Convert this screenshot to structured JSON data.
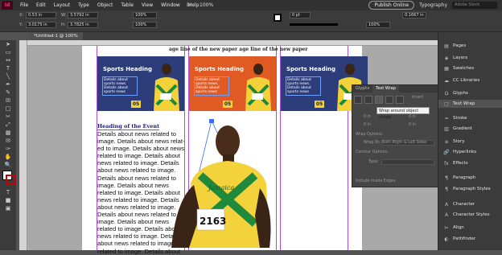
{
  "app": {
    "logo": "Id",
    "menus": [
      "File",
      "Edit",
      "Layout",
      "Type",
      "Object",
      "Table",
      "View",
      "Window",
      "Help"
    ],
    "zoom": "100%",
    "publish": "Publish Online",
    "workspace": "Typography",
    "search_placeholder": "Adobe Stock"
  },
  "control": {
    "x": "0.53 in",
    "y": "3.0175 in",
    "w": "3.5792 in",
    "h": "3.7825 in",
    "stroke_weight": "0 pt",
    "width_pct": "100%",
    "gap": "0.1667 in"
  },
  "document_tab": "*Untitled-1 @ 100%",
  "top_line": "age line of the new paper age line of the new paper",
  "cards": [
    {
      "heading": "Sports Heading",
      "body": "Details about sports news. Details about sports news",
      "number": "05",
      "color": "#2c3d7a"
    },
    {
      "heading": "Sports Heading",
      "body": "Details about sports news. Details about sports news",
      "number": "05",
      "color": "#e15a24"
    },
    {
      "heading": "Sports Heading",
      "body": "Details about sports news. Details about sports news",
      "number": "05",
      "color": "#2c3d7a"
    }
  ],
  "event": {
    "heading": "Heading of the Event",
    "lines": [
      "Details about news related to",
      "image. Details about news relat-",
      "ed to image. Details about news",
      "related to image. Details about",
      "news related to image. Details",
      "about news related to image.",
      "Details about news related to",
      "image. Details about news",
      "related to image. Details about",
      "news related to image. Details",
      "about news related to image.",
      "Details about news related to",
      "image. Details about news",
      "related to image. Details about",
      "news related to image. Details",
      "about news related to image.",
      "related to image. Details about"
    ]
  },
  "bib": {
    "team": "Jamaica",
    "number": "2163"
  },
  "panels": [
    {
      "label": "Pages",
      "icon": "pages-icon"
    },
    {
      "label": "Layers",
      "icon": "layers-icon"
    },
    {
      "label": "Swatches",
      "icon": "swatches-icon"
    },
    {
      "label": "CC Libraries",
      "icon": "libraries-icon"
    },
    {
      "label": "Glyphs",
      "icon": "glyphs-icon"
    },
    {
      "label": "Text Wrap",
      "icon": "textwrap-icon"
    },
    {
      "label": "Stroke",
      "icon": "stroke-icon"
    },
    {
      "label": "Gradient",
      "icon": "gradient-icon"
    },
    {
      "label": "Story",
      "icon": "story-icon"
    },
    {
      "label": "Hyperlinks",
      "icon": "hyperlinks-icon"
    },
    {
      "label": "Effects",
      "icon": "effects-icon"
    },
    {
      "label": "Paragraph",
      "icon": "paragraph-icon"
    },
    {
      "label": "Paragraph Styles",
      "icon": "paragraph-styles-icon"
    },
    {
      "label": "Character",
      "icon": "character-icon"
    },
    {
      "label": "Character Styles",
      "icon": "character-styles-icon"
    },
    {
      "label": "Align",
      "icon": "align-icon"
    },
    {
      "label": "Pathfinder",
      "icon": "pathfinder-icon"
    }
  ],
  "textwrap": {
    "tabs": [
      "Glyphs",
      "Text Wrap"
    ],
    "invert": "Invert",
    "tooltip": "Wrap around object shape",
    "offset_top": "0 in",
    "offset_bottom": "0 in",
    "offset_left": "0 in",
    "offset_right": "0 in",
    "wrap_options": "Wrap Options:",
    "wrap_to_label": "Wrap To:",
    "wrap_to": "Both Right & Left Sides",
    "contour_options": "Contour Options:",
    "type_label": "Type:",
    "include_edges": "Include Inside Edges"
  }
}
